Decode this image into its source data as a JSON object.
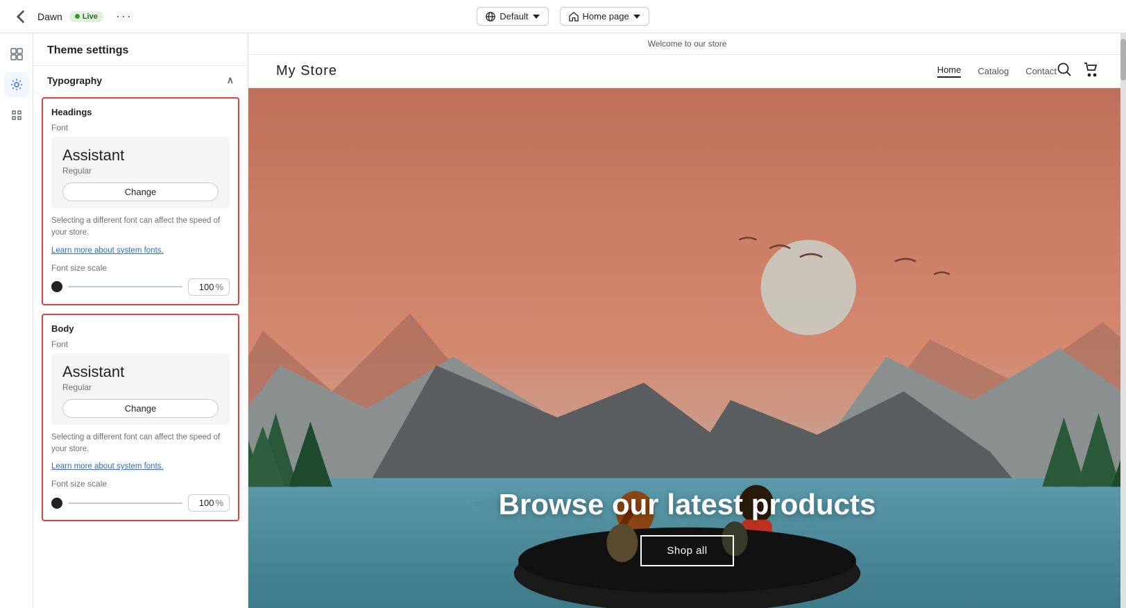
{
  "topbar": {
    "store_name": "Dawn",
    "live_label": "Live",
    "more_label": "···",
    "default_label": "Default",
    "homepage_label": "Home page"
  },
  "settings": {
    "title": "Theme settings",
    "section_title": "Typography",
    "headings": {
      "label": "Headings",
      "font_label": "Font",
      "font_name": "Assistant",
      "font_style": "Regular",
      "change_label": "Change",
      "note": "Selecting a different font can affect the speed of your store.",
      "link": "Learn more about system fonts.",
      "size_label": "Font size scale",
      "size_value": "100",
      "size_percent": "%"
    },
    "body": {
      "label": "Body",
      "font_label": "Font",
      "font_name": "Assistant",
      "font_style": "Regular",
      "change_label": "Change",
      "note": "Selecting a different font can affect the speed of your store.",
      "link": "Learn more about system fonts.",
      "size_label": "Font size scale",
      "size_value": "100",
      "size_percent": "%"
    }
  },
  "store": {
    "announcement": "Welcome to our store",
    "logo": "My Store",
    "nav_links": [
      "Home",
      "Catalog",
      "Contact"
    ],
    "hero_title": "Browse our latest products",
    "shop_all": "Shop all"
  },
  "icons": {
    "back": "←",
    "grid": "⊞",
    "gear": "⚙",
    "apps": "⋮⋮",
    "globe": "🌐",
    "home": "⌂",
    "search": "🔍",
    "cart": "🛒",
    "chevron_up": "∧",
    "chevron_down": "∨"
  }
}
